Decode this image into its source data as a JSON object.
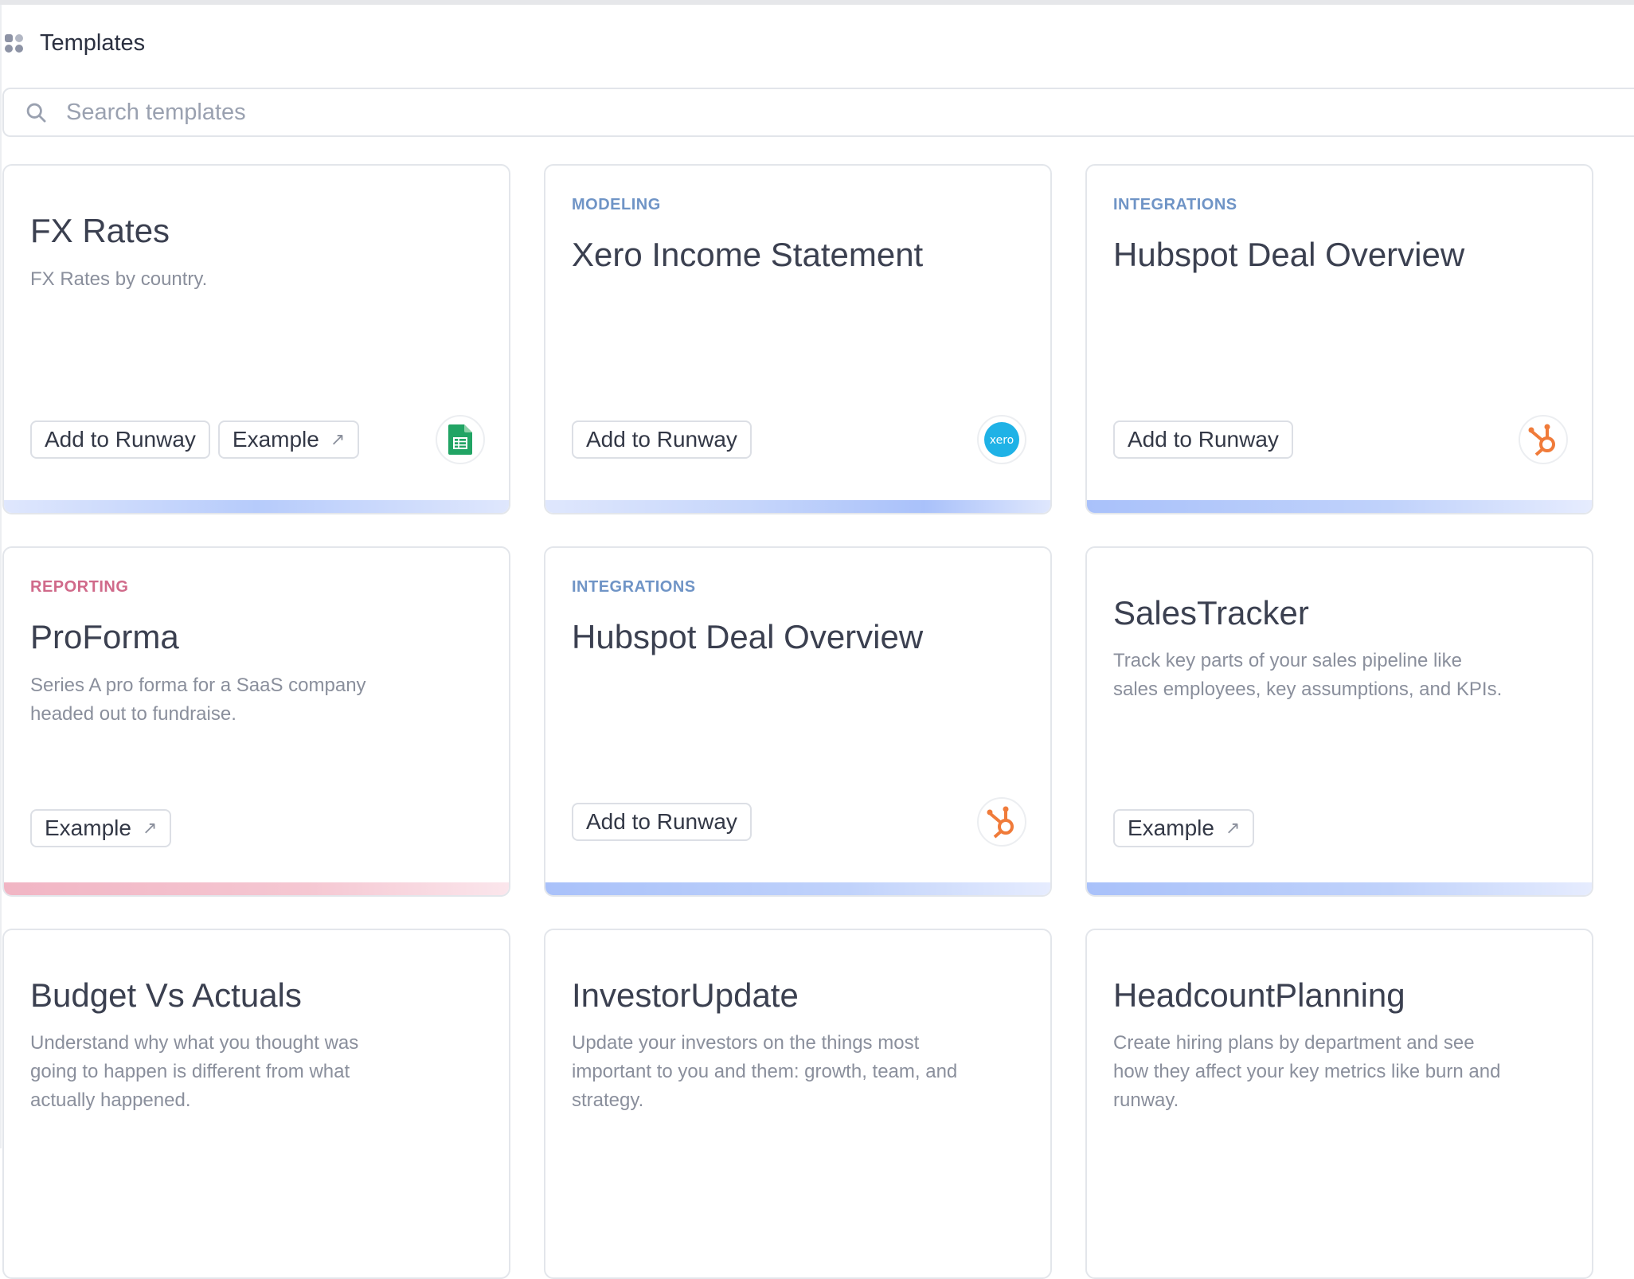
{
  "header": {
    "title": "Templates",
    "icon": "templates-grid-icon"
  },
  "search": {
    "placeholder": "Search templates",
    "value": ""
  },
  "colors": {
    "modeling": "#6f94c6",
    "integrations": "#6f94c6",
    "reporting": "#d06a8a",
    "sheets_green": "#21a464",
    "xero_blue": "#1fb2e6",
    "hubspot_orange": "#f07b3a"
  },
  "cards": [
    {
      "category": "",
      "title": "FX Rates",
      "description": "FX Rates by country.",
      "buttons": [
        "Add to Runway",
        "Example"
      ],
      "logo": "google-sheets-icon"
    },
    {
      "category": "MODELING",
      "title": "Xero Income Statement",
      "description": "",
      "buttons": [
        "Add to Runway"
      ],
      "logo": "xero-icon"
    },
    {
      "category": "INTEGRATIONS",
      "title": "Hubspot Deal Overview",
      "description": "",
      "buttons": [
        "Add to Runway"
      ],
      "logo": "hubspot-icon"
    },
    {
      "category": "REPORTING",
      "title": "ProForma",
      "description": "Series A pro forma for a SaaS company headed out to fundraise.",
      "buttons": [
        "Example"
      ],
      "logo": ""
    },
    {
      "category": "INTEGRATIONS",
      "title": "Hubspot Deal Overview",
      "description": "",
      "buttons": [
        "Add to Runway"
      ],
      "logo": "hubspot-icon"
    },
    {
      "category": "",
      "title": "SalesTracker",
      "description": "Track key parts of your sales pipeline like sales employees, key assumptions, and KPIs.",
      "buttons": [
        "Example"
      ],
      "logo": ""
    },
    {
      "category": "",
      "title": "Budget Vs Actuals",
      "description": "Understand why what you thought was going to happen is different from what actually happened.",
      "buttons": [],
      "logo": ""
    },
    {
      "category": "",
      "title": "InvestorUpdate",
      "description": "Update your investors on the things most important to you and them: growth, team, and strategy.",
      "buttons": [],
      "logo": ""
    },
    {
      "category": "",
      "title": "HeadcountPlanning",
      "description": "Create hiring plans by department and see how they affect your key metrics like burn and runway.",
      "buttons": [],
      "logo": ""
    }
  ]
}
